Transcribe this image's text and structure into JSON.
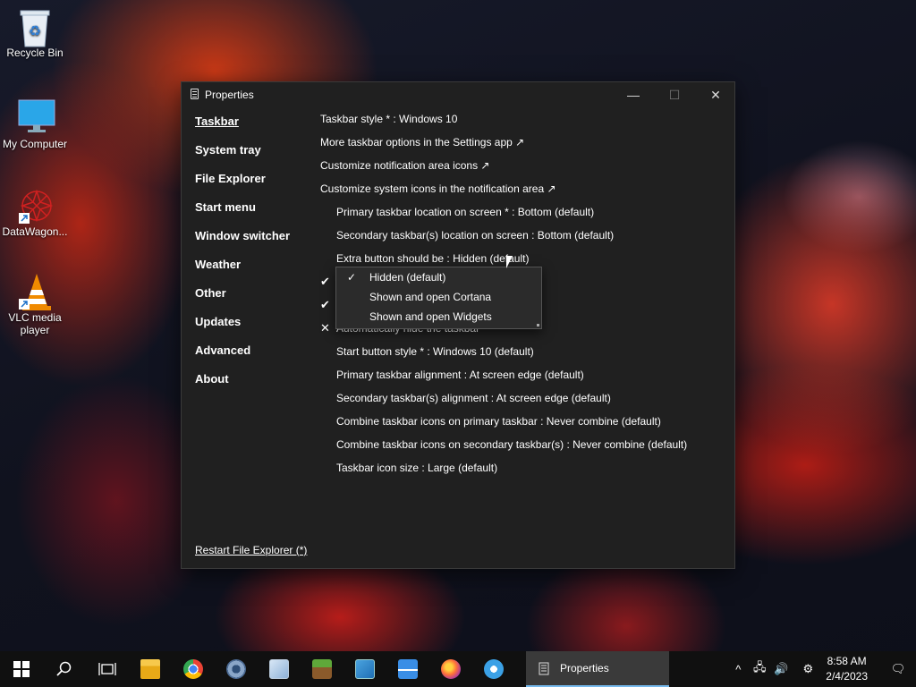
{
  "desktop": {
    "icons": [
      {
        "label": "Recycle Bin"
      },
      {
        "label": "My Computer"
      },
      {
        "label": "DataWagon..."
      },
      {
        "label": "VLC media player"
      }
    ]
  },
  "window": {
    "title": "Properties",
    "controls": {
      "minimize": "—",
      "maximize": "☐",
      "close": "✕"
    },
    "nav": [
      "Taskbar",
      "System tray",
      "File Explorer",
      "Start menu",
      "Window switcher",
      "Weather",
      "Other",
      "Updates",
      "Advanced",
      "About"
    ],
    "content": {
      "taskbar_style": "Taskbar style * : Windows 10",
      "settings_app": "More taskbar options in the Settings app ↗",
      "notif_icons": "Customize notification area icons ↗",
      "system_icons": "Customize system icons in the notification area ↗",
      "primary_location": "Primary taskbar location on screen * : Bottom (default)",
      "secondary_location": "Secondary taskbar(s) location on screen : Bottom (default)",
      "extra_button": "Extra button should be : Hidden (default)",
      "check1": "✔",
      "check2": "✔",
      "autohide_mark": "✕",
      "autohide": "Automatically hide the taskbar",
      "start_style": "Start button style * : Windows 10 (default)",
      "primary_align": "Primary taskbar alignment : At screen edge (default)",
      "secondary_align": "Secondary taskbar(s) alignment : At screen edge (default)",
      "combine_primary": "Combine taskbar icons on primary taskbar : Never combine (default)",
      "combine_secondary": "Combine taskbar icons on secondary taskbar(s) : Never combine (default)",
      "icon_size": "Taskbar icon size : Large (default)"
    },
    "restart": "Restart File Explorer (*)"
  },
  "dropdown": {
    "check": "✓",
    "options": [
      "Hidden (default)",
      "Shown and open Cortana",
      "Shown and open Widgets"
    ]
  },
  "taskbar": {
    "active_label": "Properties",
    "tray": {
      "chevron": "^",
      "network": "🖧",
      "volume": "🔊",
      "gear": "⚙",
      "notif": "🗨"
    },
    "time": "8:58 AM",
    "date": "2/4/2023"
  }
}
